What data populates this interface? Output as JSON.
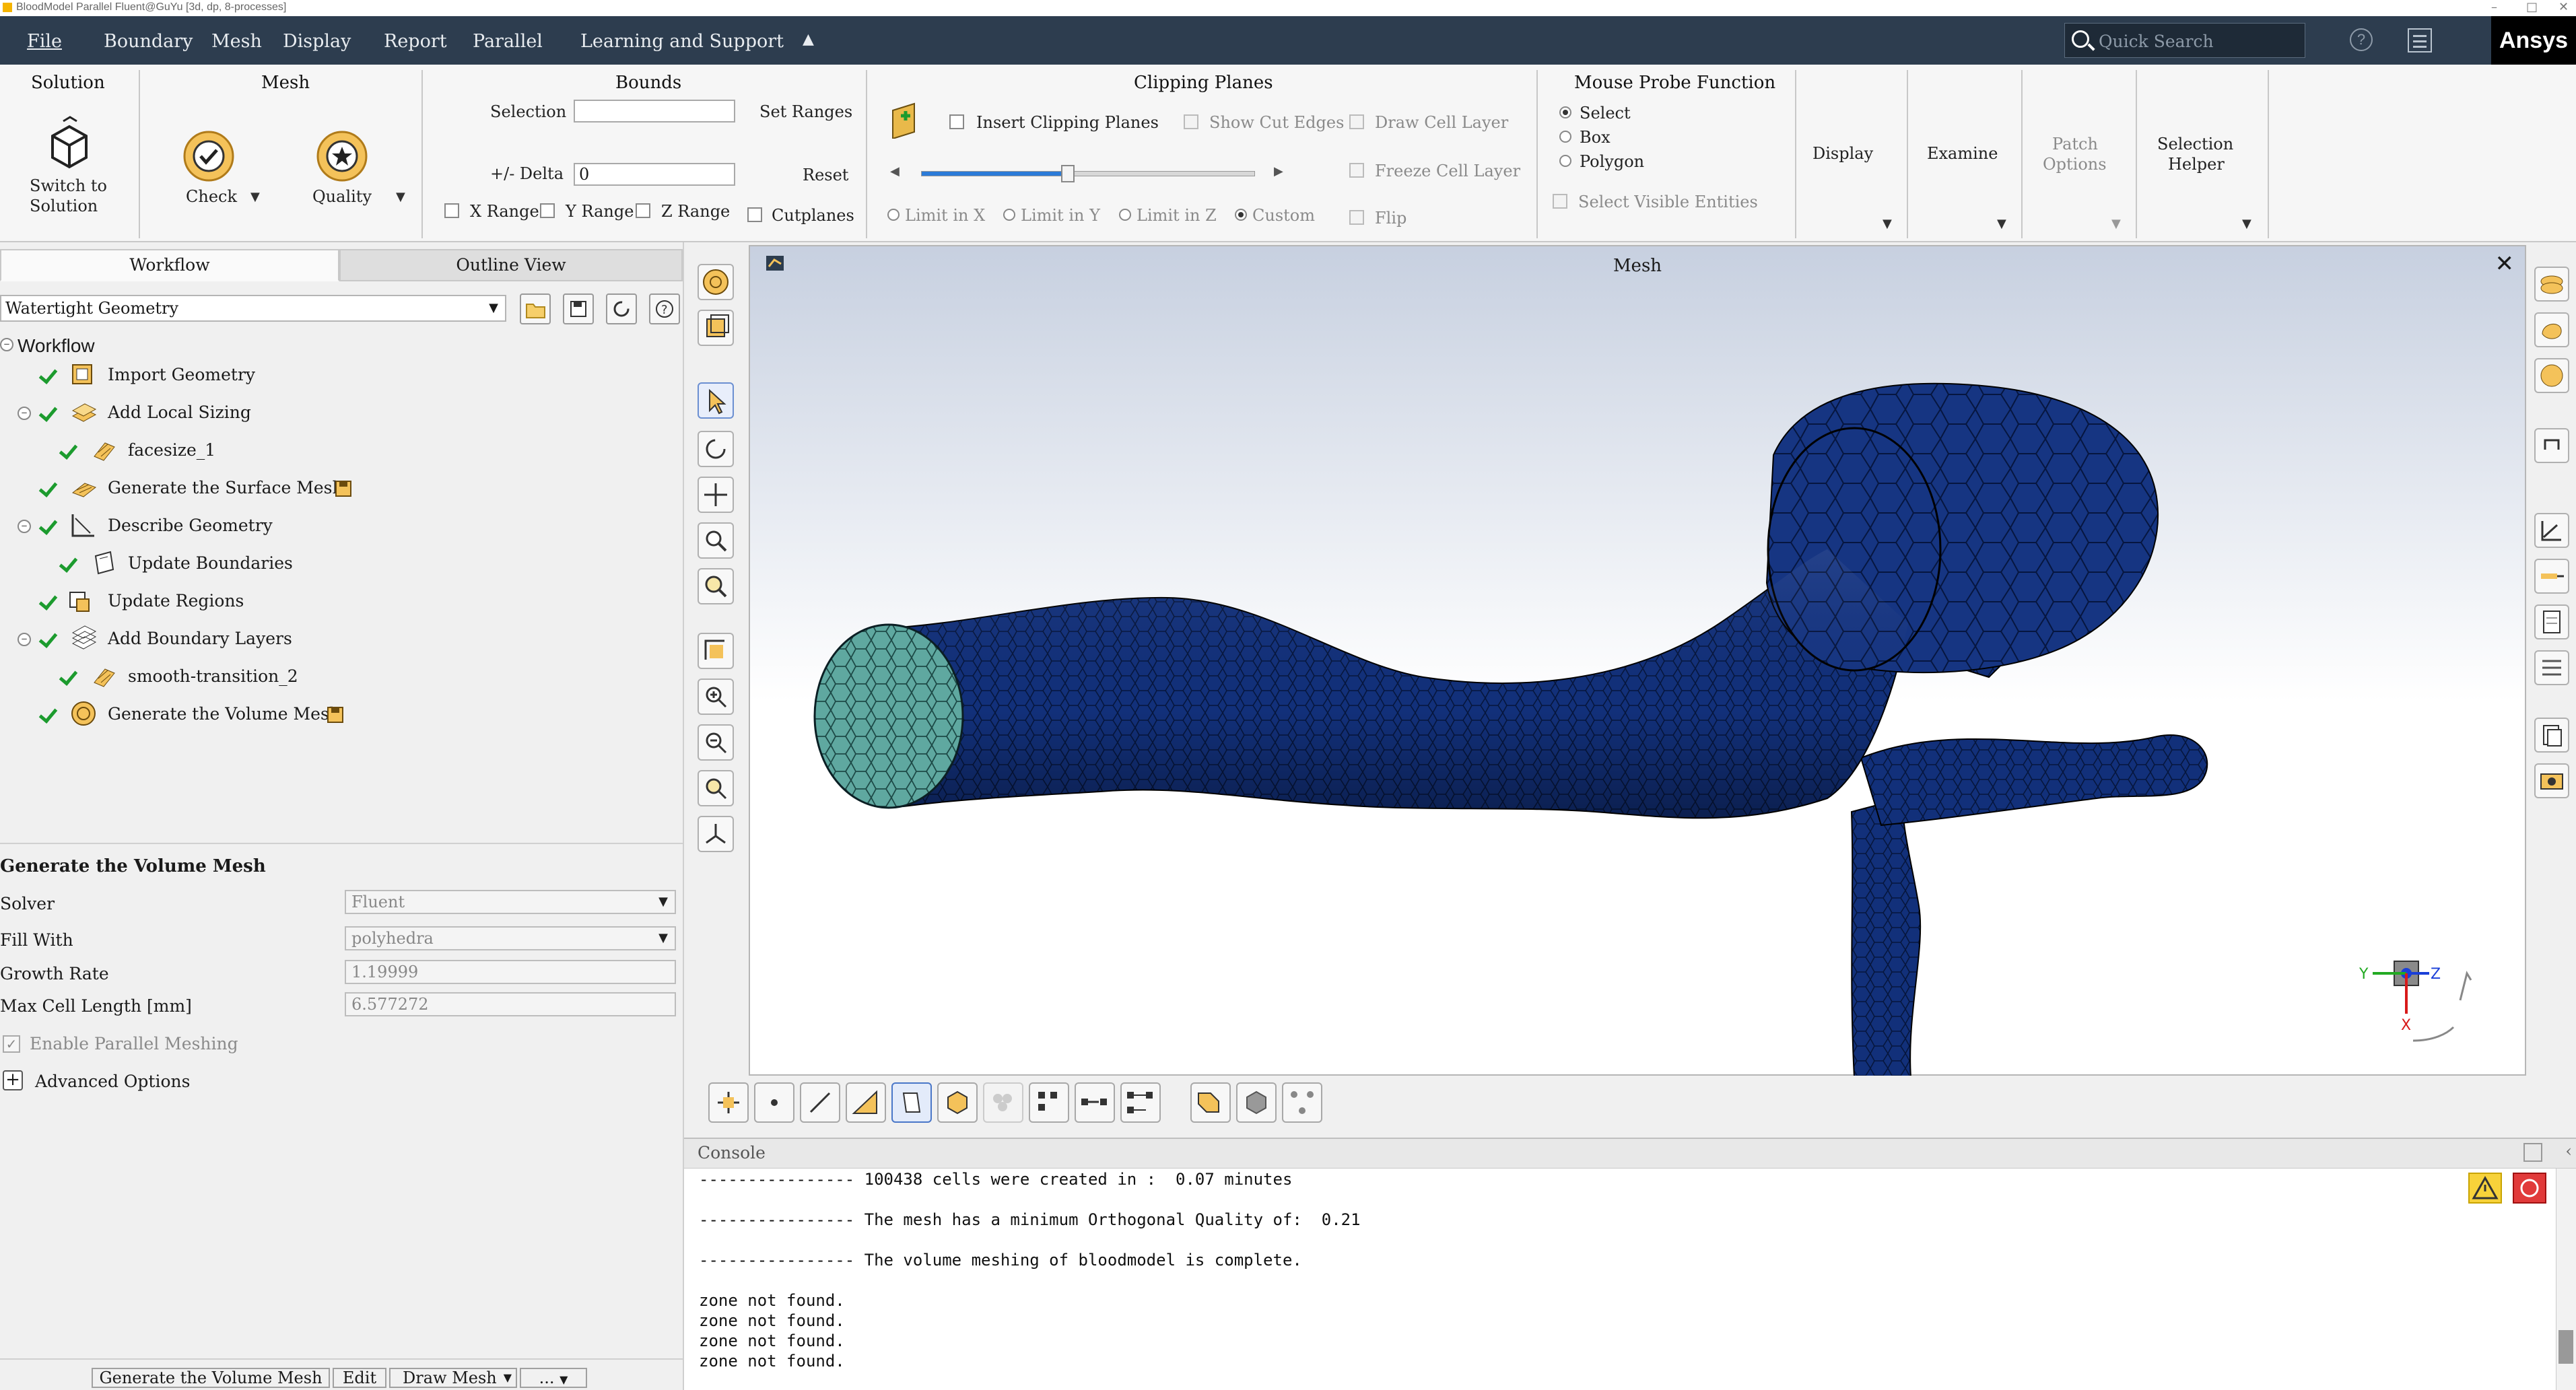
{
  "window": {
    "title": "BloodModel Parallel Fluent@GuYu  [3d, dp, 8-processes]"
  },
  "menu": {
    "items": [
      "File",
      "Boundary",
      "Mesh",
      "Display",
      "Report",
      "Parallel",
      "Learning and Support"
    ],
    "search_placeholder": "Quick Search",
    "help_label": "?",
    "brand": "Ansys"
  },
  "ribbon": {
    "solution": {
      "header": "Solution",
      "switch_label_1": "Switch to",
      "switch_label_2": "Solution"
    },
    "mesh": {
      "header": "Mesh",
      "check_label": "Check",
      "quality_label": "Quality"
    },
    "bounds": {
      "header": "Bounds",
      "selection_label": "Selection",
      "selection_value": "",
      "set_ranges_label": "Set Ranges",
      "delta_label": "+/- Delta",
      "delta_value": "0",
      "reset_label": "Reset",
      "x_range": "X Range",
      "y_range": "Y Range",
      "z_range": "Z Range",
      "cutplanes": "Cutplanes"
    },
    "clipping": {
      "header": "Clipping Planes",
      "insert": "Insert Clipping Planes",
      "show_cut_edges": "Show Cut Edges",
      "draw_cell_layer": "Draw Cell Layer",
      "freeze_cell_layer": "Freeze Cell Layer",
      "flip": "Flip",
      "limit_x": "Limit in X",
      "limit_y": "Limit in Y",
      "limit_z": "Limit in Z",
      "custom": "Custom",
      "slider_fraction": 0.44
    },
    "probe": {
      "header": "Mouse Probe Function",
      "options": [
        "Select",
        "Box",
        "Polygon"
      ],
      "selected": "Select",
      "select_visible": "Select Visible Entities"
    },
    "display_label": "Display",
    "examine_label": "Examine",
    "patch_label_1": "Patch",
    "patch_label_2": "Options",
    "selhelper_label_1": "Selection",
    "selhelper_label_2": "Helper"
  },
  "left": {
    "tabs": [
      "Workflow",
      "Outline View"
    ],
    "workflow_select": "Watertight Geometry",
    "workflow_root": "Workflow",
    "tree": [
      {
        "label": "Import Geometry"
      },
      {
        "label": "Add Local Sizing"
      },
      {
        "label": "facesize_1"
      },
      {
        "label": "Generate the Surface Mesh"
      },
      {
        "label": "Describe Geometry"
      },
      {
        "label": "Update Boundaries"
      },
      {
        "label": "Update Regions"
      },
      {
        "label": "Add Boundary Layers"
      },
      {
        "label": "smooth-transition_2"
      },
      {
        "label": "Generate the Volume Mesh"
      }
    ],
    "task": {
      "title": "Generate the Volume Mesh",
      "solver_label": "Solver",
      "solver_value": "Fluent",
      "fill_label": "Fill With",
      "fill_value": "polyhedra",
      "growth_label": "Growth Rate",
      "growth_value": "1.19999",
      "maxcell_label": "Max Cell Length [mm]",
      "maxcell_value": "6.577272",
      "parallel_label": "Enable Parallel Meshing",
      "advanced_label": "Advanced Options"
    },
    "buttons": {
      "generate": "Generate the Volume Mesh",
      "edit": "Edit",
      "draw": "Draw Mesh",
      "more": "..."
    }
  },
  "graphics": {
    "title": "Mesh",
    "close": "✕"
  },
  "console": {
    "title": "Console",
    "lines": [
      "---------------- 100438 cells were created in :  0.07 minutes",
      "",
      "---------------- The mesh has a minimum Orthogonal Quality of:  0.21",
      "",
      "---------------- The volume meshing of bloodmodel is complete.",
      "",
      "zone not found.",
      "zone not found.",
      "zone not found.",
      "zone not found."
    ]
  },
  "colors": {
    "menu_bg": "#2d3d4f",
    "mesh_blue": "#112d73",
    "mesh_cap": "#5fa8a0",
    "check_green": "#1c9b2e"
  }
}
